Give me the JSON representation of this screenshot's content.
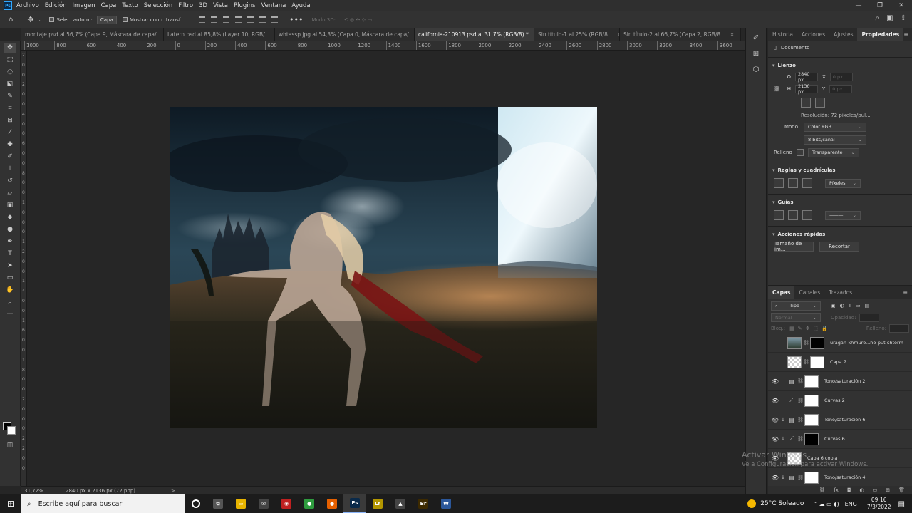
{
  "menu": {
    "app_logo": "Ps",
    "items": [
      "Archivo",
      "Edición",
      "Imagen",
      "Capa",
      "Texto",
      "Selección",
      "Filtro",
      "3D",
      "Vista",
      "Plugins",
      "Ventana",
      "Ayuda"
    ]
  },
  "options": {
    "auto_select_label": "Selec. autom.:",
    "auto_select_value": "Capa",
    "show_transform_label": "Mostrar contr. transf.",
    "mode_3d_label": "Modo 3D:",
    "more": "•••"
  },
  "doc_tabs": [
    {
      "label": "montaje.psd al 56,7% (Capa 9, Máscara de capa/...",
      "active": false
    },
    {
      "label": "Latern.psd al 85,8% (Layer 10, RGB/...",
      "active": false
    },
    {
      "label": "whtassp.jpg al 54,3% (Capa 0, Máscara de capa/...",
      "active": false
    },
    {
      "label": "california-210913.psd al 31,7% (RGB/8) *",
      "active": true
    },
    {
      "label": "Sin título-1 al 25% (RGB/8...",
      "active": false
    },
    {
      "label": "Sin título-2 al 66,7% (Capa 2, RGB/8...",
      "active": false
    }
  ],
  "ruler": {
    "top": [
      "1000",
      "800",
      "600",
      "400",
      "200",
      "0",
      "200",
      "400",
      "600",
      "800",
      "1000",
      "1200",
      "1400",
      "1600",
      "1800",
      "2000",
      "2200",
      "2400",
      "2600",
      "2800",
      "3000",
      "3200",
      "3400",
      "3600"
    ],
    "left": [
      "2",
      "0",
      "0",
      "2",
      "0",
      "0",
      "4",
      "0",
      "0",
      "6",
      "0",
      "0",
      "8",
      "0",
      "0",
      "1",
      "0",
      "0",
      "0",
      "1",
      "2",
      "0",
      "0",
      "1",
      "4",
      "0",
      "0",
      "1",
      "6",
      "0",
      "0",
      "1",
      "8",
      "0",
      "0",
      "2",
      "0",
      "0",
      "0",
      "2",
      "2",
      "0",
      "0"
    ]
  },
  "status": {
    "zoom": "31,72%",
    "dimensions": "2840 px x 2136 px (72 ppp)",
    "arrow": ">"
  },
  "panel_tabs": [
    "Historia",
    "Acciones",
    "Ajustes",
    "Propiedades"
  ],
  "properties": {
    "doc_label": "Documento",
    "canvas_section": "Lienzo",
    "w_label": "O",
    "w_value": "2840 px",
    "h_label": "H",
    "h_value": "2136 px",
    "x_label": "X",
    "x_value": "0 px",
    "y_label": "Y",
    "y_value": "0 px",
    "resolution": "Resolución: 72 píxeles/pul...",
    "mode_label": "Modo",
    "mode_value": "Color RGB",
    "depth_value": "8 bits/canal",
    "fill_label": "Relleno",
    "fill_value": "Transparente",
    "rulers_section": "Reglas y cuadrículas",
    "units_value": "Píxeles",
    "guides_section": "Guías",
    "quick_section": "Acciones rápidas",
    "image_size_button": "Tamaño de im...",
    "crop_button": "Recortar"
  },
  "layers_panel": {
    "tabs": [
      "Capas",
      "Canales",
      "Trazados"
    ],
    "filter_value": "Tipo",
    "blend_value": "Normal",
    "opacity_label": "Opacidad:",
    "lock_label": "Bloq.:",
    "fill_label": "Relleno:",
    "layers": [
      {
        "name": "uragan-khmuro...ho-put-shtorm",
        "visible": false,
        "thumb": "photo-t",
        "mask": "mask",
        "clip": false,
        "adj": ""
      },
      {
        "name": "Capa 7",
        "visible": false,
        "thumb": "check",
        "mask": "white",
        "clip": false,
        "adj": ""
      },
      {
        "name": "Tono/saturación 2",
        "visible": true,
        "thumb": "white",
        "mask": "",
        "clip": false,
        "adj": "▤"
      },
      {
        "name": "Curvas 2",
        "visible": true,
        "thumb": "white",
        "mask": "",
        "clip": false,
        "adj": "⟋"
      },
      {
        "name": "Tono/saturación 6",
        "visible": true,
        "thumb": "white",
        "mask": "",
        "clip": true,
        "adj": "▤"
      },
      {
        "name": "Curvas 6",
        "visible": true,
        "thumb": "mask",
        "mask": "",
        "clip": true,
        "adj": "⟋"
      },
      {
        "name": "Capa 6 copia",
        "visible": true,
        "thumb": "check",
        "mask": "",
        "clip": false,
        "adj": ""
      },
      {
        "name": "Tono/saturación 4",
        "visible": true,
        "thumb": "white",
        "mask": "",
        "clip": true,
        "adj": "▤"
      }
    ]
  },
  "watermark": {
    "title": "Activar Windows",
    "subtitle": "Ve a Configuración para activar Windows."
  },
  "taskbar": {
    "search_placeholder": "Escribe aquí para buscar",
    "weather": "25°C  Soleado",
    "lang": "ENG",
    "time": "09:16",
    "date": "7/3/2022",
    "apps": [
      {
        "name": "task-view",
        "label": "⧉",
        "color": "#555"
      },
      {
        "name": "explorer",
        "label": "▭",
        "color": "#e8b400"
      },
      {
        "name": "mail",
        "label": "✉",
        "color": "#444"
      },
      {
        "name": "app-red",
        "label": "◉",
        "color": "#c02020"
      },
      {
        "name": "chrome",
        "label": "●",
        "color": "#2e9b3e"
      },
      {
        "name": "firefox",
        "label": "●",
        "color": "#e66000"
      },
      {
        "name": "photoshop",
        "label": "Ps",
        "color": "#0a2a4a"
      },
      {
        "name": "illustrator-like",
        "label": "Lr",
        "color": "#b39600"
      },
      {
        "name": "photos",
        "label": "▲",
        "color": "#444"
      },
      {
        "name": "bridge",
        "label": "Br",
        "color": "#3d2a00"
      },
      {
        "name": "word",
        "label": "W",
        "color": "#2b579a"
      }
    ]
  },
  "colors": {
    "accent": "#31a8ff",
    "panel_bg": "#323232",
    "canvas_bg": "#262626"
  }
}
